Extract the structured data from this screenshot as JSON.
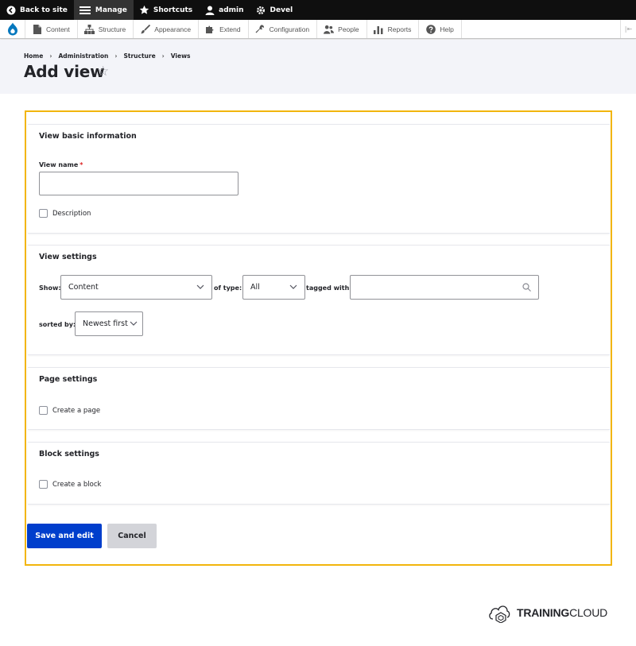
{
  "toolbar": {
    "back_label": "Back to site",
    "manage_label": "Manage",
    "shortcuts_label": "Shortcuts",
    "user_label": "admin",
    "devel_label": "Devel"
  },
  "tray": {
    "items": [
      {
        "label": "Content",
        "icon": "page-icon"
      },
      {
        "label": "Structure",
        "icon": "sitemap-icon"
      },
      {
        "label": "Appearance",
        "icon": "paintbrush-icon"
      },
      {
        "label": "Extend",
        "icon": "puzzle-icon"
      },
      {
        "label": "Configuration",
        "icon": "wrench-icon"
      },
      {
        "label": "People",
        "icon": "people-icon"
      },
      {
        "label": "Reports",
        "icon": "bar-chart-icon"
      },
      {
        "label": "Help",
        "icon": "question-icon"
      }
    ],
    "toggle": "|⇤"
  },
  "breadcrumb": [
    "Home",
    "Administration",
    "Structure",
    "Views"
  ],
  "breadcrumb_sep": "›",
  "page_title": "Add view",
  "basic": {
    "title": "View basic information",
    "name_label": "View name",
    "required_mark": "*",
    "name_value": "",
    "description_label": "Description"
  },
  "settings": {
    "title": "View settings",
    "show_label": "Show:",
    "show_value": "Content",
    "type_label": "of type:",
    "type_value": "All",
    "tagged_label": "tagged with:",
    "tagged_value": "",
    "sorted_label": "sorted by:",
    "sorted_value": "Newest first"
  },
  "page_settings": {
    "title": "Page settings",
    "create_label": "Create a page"
  },
  "block_settings": {
    "title": "Block settings",
    "create_label": "Create a block"
  },
  "actions": {
    "save": "Save and edit",
    "cancel": "Cancel"
  },
  "brand": {
    "bold": "TRAINING",
    "normal": "CLOUD"
  },
  "colors": {
    "highlight": "#f2b50c",
    "primary": "#003ecc",
    "required": "#dc2323",
    "drupal_blue": "#0678be"
  }
}
